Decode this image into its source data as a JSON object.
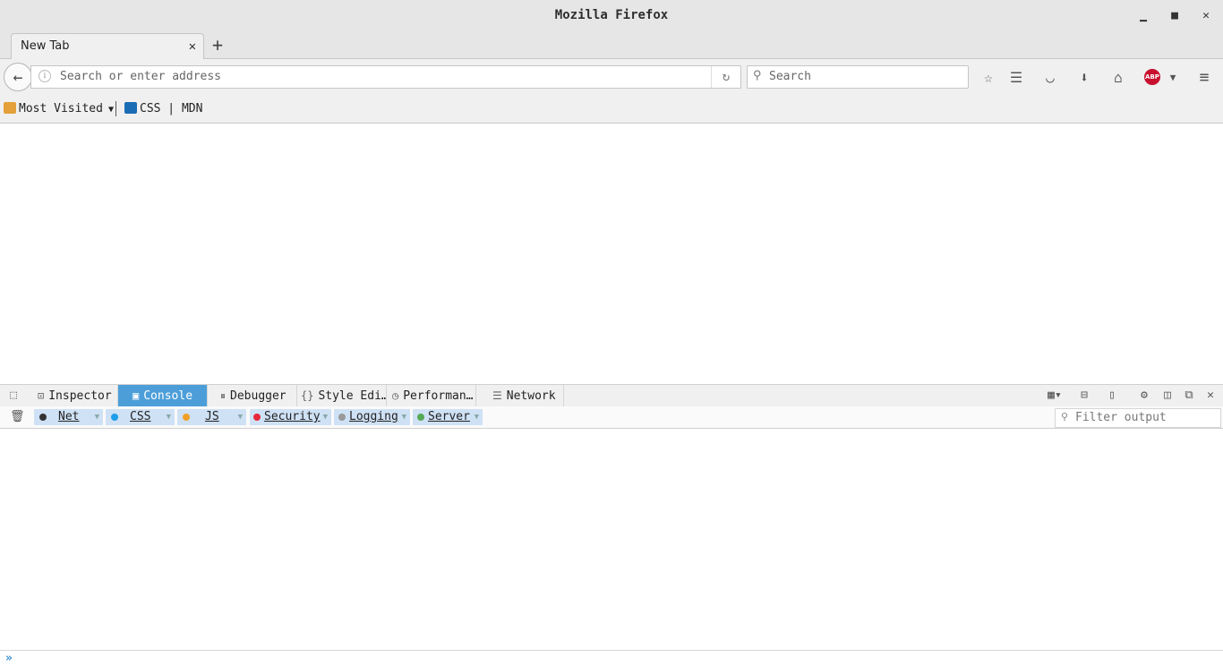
{
  "window": {
    "title": "Mozilla Firefox"
  },
  "tabs": [
    {
      "label": "New Tab"
    }
  ],
  "navbar": {
    "url_placeholder": "Search or enter address",
    "search_placeholder": "Search",
    "abp_label": "ABP"
  },
  "bookmarks": [
    {
      "label": "Most Visited"
    },
    {
      "label": "CSS | MDN"
    }
  ],
  "devtools": {
    "tabs": [
      {
        "label": "Inspector"
      },
      {
        "label": "Console"
      },
      {
        "label": "Debugger"
      },
      {
        "label": "Style Edi…"
      },
      {
        "label": "Performan…"
      },
      {
        "label": "Network"
      }
    ],
    "active_tab": "Console",
    "accent_color": "#4c9ed9",
    "filters": [
      {
        "label": "Net",
        "color": "#333333"
      },
      {
        "label": "CSS",
        "color": "#1e9ee8"
      },
      {
        "label": "JS",
        "color": "#f0a029"
      },
      {
        "label": "Security",
        "color": "#e8263a"
      },
      {
        "label": "Logging",
        "color": "#999999"
      },
      {
        "label": "Server",
        "color": "#55aa55"
      }
    ],
    "filter_placeholder": "Filter output",
    "prompt": "»"
  }
}
